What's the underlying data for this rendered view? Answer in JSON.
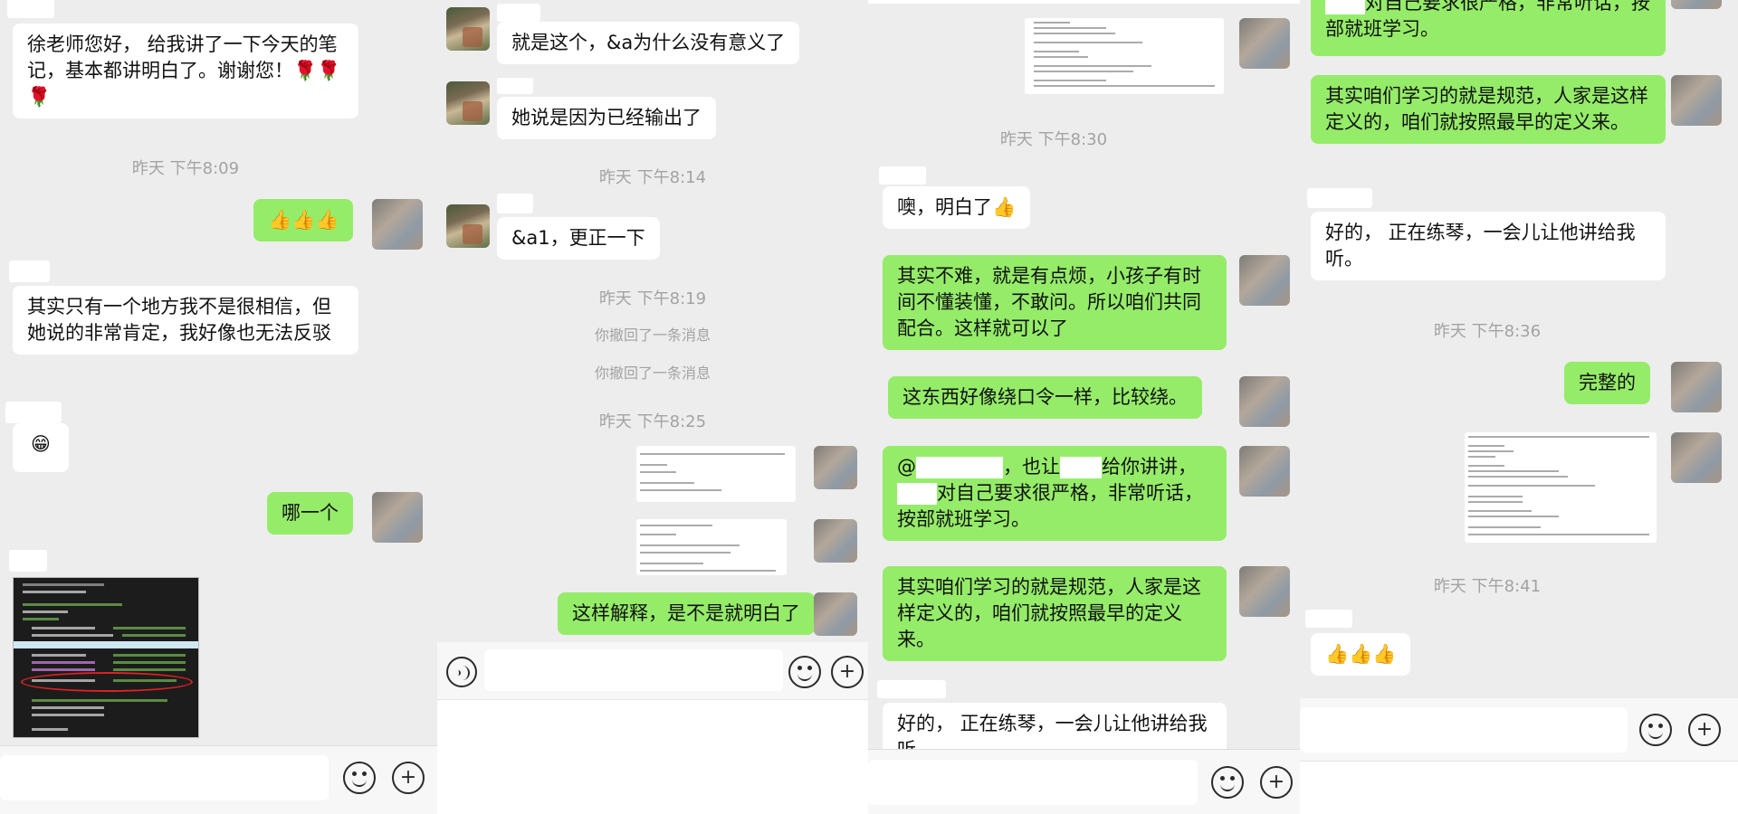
{
  "panel1": {
    "msg_thanks": "徐老师您好，        给我讲了一下今天的笔记，基本都讲明白了。谢谢您！🌹🌹🌹",
    "time1": "昨天 下午8:09",
    "msg_thumbs": "👍👍👍",
    "msg_doubt": "其实只有一个地方我不是很相信，但她说的非常肯定，我好像也无法反驳",
    "msg_grin": "😁",
    "msg_which": "哪一个"
  },
  "panel2": {
    "msg_this_one": "就是这个，&a为什么没有意义了",
    "msg_output": "她说是因为已经输出了",
    "msg_correct": "&a1，更正一下",
    "time_814": "昨天 下午8:14",
    "time_819": "昨天 下午8:19",
    "recall1": "你撤回了一条消息",
    "recall2": "你撤回了一条消息",
    "time_825": "昨天 下午8:25",
    "msg_explain": "这样解释，是不是就明白了"
  },
  "panel3": {
    "time_830": "昨天 下午8:30",
    "msg_understood": "噢，明白了👍",
    "msg_not_hard": "其实不难，就是有点烦，小孩子有时间不懂装懂，不敢问。所以咱们共同配合。这样就可以了",
    "msg_tongue_twister": "这东西好像绕口令一样，比较绕。",
    "msg_at_part1": "@",
    "msg_at_part2": "，也让",
    "msg_at_part3": "给你讲讲，",
    "msg_at_part4": "对自己要求很严格，非常听话，按部就班学习。",
    "msg_standard": "其实咱们学习的就是规范，人家是这样定义的，咱们就按照最早的定义来。",
    "msg_ok_piano": "好的，        正在练琴，一会儿让他讲给我听。"
  },
  "panel4": {
    "msg_strict_tail": "对自己要求很严格，非常听话，按部就班学习。",
    "msg_standard": "其实咱们学习的就是规范，人家是这样定义的，咱们就按照最早的定义来。",
    "msg_ok_piano": "好的，        正在练琴，一会儿让他讲给我听。",
    "time_836": "昨天 下午8:36",
    "msg_complete": "完整的",
    "time_841": "昨天 下午8:41",
    "msg_thumbs": "👍👍👍"
  },
  "colors": {
    "chat_bg": "#ededed",
    "bubble_self": "#95ec69",
    "bubble_other": "#ffffff",
    "timestamp": "#a3a3a3"
  },
  "icons": [
    "voice-icon",
    "emoji-icon",
    "plus-icon"
  ]
}
